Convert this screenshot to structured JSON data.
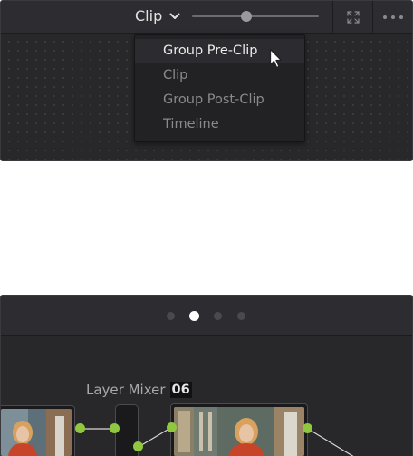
{
  "top_panel": {
    "header": {
      "mode_label": "Clip",
      "zoom_slider_level": 0.43
    },
    "dropdown": {
      "items": [
        {
          "label": "Group Pre-Clip",
          "selected": true
        },
        {
          "label": "Clip",
          "selected": false
        },
        {
          "label": "Group Post-Clip",
          "selected": false
        },
        {
          "label": "Timeline",
          "selected": false
        }
      ]
    }
  },
  "bottom_panel": {
    "page_indicator": {
      "count": 4,
      "active_index": 1
    },
    "layer_mixer": {
      "label": "Layer Mixer",
      "number": "06"
    }
  },
  "colors": {
    "panel_bg": "#28282b",
    "header_bg": "#2d2d31",
    "menu_selected_text": "#ececec",
    "menu_text": "#8a8a8e",
    "connector": "#8fc73e",
    "active_dot": "#ffffff"
  },
  "icons": {
    "dropdown": "chevron-down-icon",
    "expand": "expand-icon",
    "more": "more-options-icon",
    "pointer": "mouse-pointer-icon"
  }
}
